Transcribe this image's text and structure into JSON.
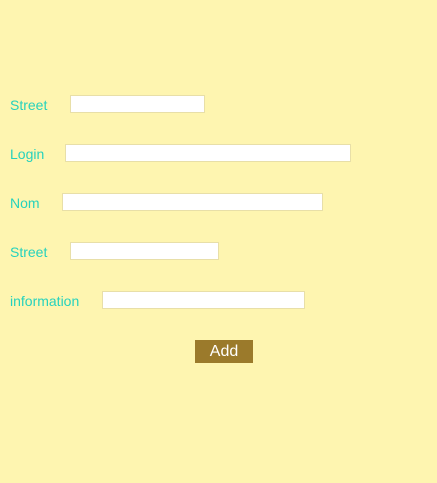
{
  "form": {
    "fields": [
      {
        "label": "Street",
        "value": ""
      },
      {
        "label": "Login",
        "value": ""
      },
      {
        "label": "Nom",
        "value": ""
      },
      {
        "label": "Street",
        "value": ""
      },
      {
        "label": "information",
        "value": ""
      }
    ],
    "submit_label": "Add"
  },
  "colors": {
    "background": "#fef5b0",
    "label_text": "#26d2bd",
    "button_background": "#9b7a2b",
    "button_text": "#ffffff",
    "input_background": "#ffffff"
  }
}
